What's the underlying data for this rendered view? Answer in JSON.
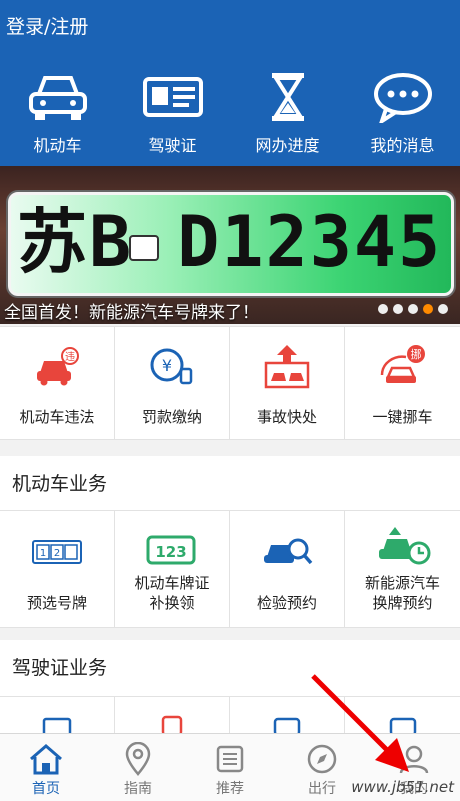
{
  "header": {
    "login_label": "登录/注册",
    "quick": [
      {
        "label": "机动车",
        "icon": "car-icon"
      },
      {
        "label": "驾驶证",
        "icon": "license-card-icon"
      },
      {
        "label": "网办进度",
        "icon": "hourglass-icon"
      },
      {
        "label": "我的消息",
        "icon": "message-bubble-icon"
      }
    ]
  },
  "banner": {
    "plate_text": "苏B D12345",
    "caption": "全国首发！新能源汽车号牌来了！",
    "active_dot": 4,
    "dot_count": 5
  },
  "services_top": [
    {
      "label": "机动车违法",
      "icon": "car-violation-icon"
    },
    {
      "label": "罚款缴纳",
      "icon": "yuan-payment-icon"
    },
    {
      "label": "事故快处",
      "icon": "accident-icon"
    },
    {
      "label": "一键挪车",
      "icon": "move-car-icon"
    }
  ],
  "vehicle_section": {
    "title": "机动车业务",
    "items": [
      {
        "line1": "预选号牌",
        "line2": "",
        "icon": "plate-select-icon"
      },
      {
        "line1": "机动车牌证",
        "line2": "补换领",
        "icon": "plate-123-icon"
      },
      {
        "line1": "检验预约",
        "line2": "",
        "icon": "inspection-icon"
      },
      {
        "line1": "新能源汽车",
        "line2": "换牌预约",
        "icon": "new-energy-car-icon"
      }
    ]
  },
  "license_section": {
    "title": "驾驶证业务"
  },
  "tabbar": {
    "tabs": [
      {
        "label": "首页",
        "icon": "home-icon",
        "active": true
      },
      {
        "label": "指南",
        "icon": "location-pin-icon",
        "active": false
      },
      {
        "label": "推荐",
        "icon": "list-icon",
        "active": false
      },
      {
        "label": "出行",
        "icon": "compass-icon",
        "active": false
      },
      {
        "label": "我的",
        "icon": "user-icon",
        "active": false
      }
    ]
  },
  "watermark": "www.jb51.net",
  "colors": {
    "brand": "#1b63b5",
    "accent": "#e8453c",
    "dot_active": "#ff8a00"
  }
}
